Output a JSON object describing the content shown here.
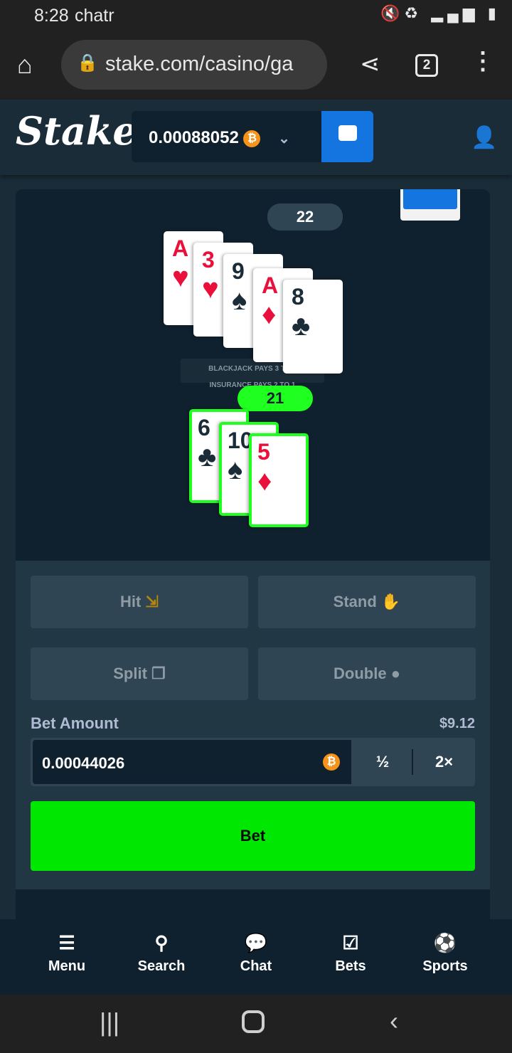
{
  "status": {
    "time": "8:28",
    "carrier": "chatr"
  },
  "browser": {
    "url": "stake.com/casino/ga",
    "tab_count": "2"
  },
  "header": {
    "logo": "Stake",
    "balance": "0.00088052",
    "currency_icon": "bitcoin-icon"
  },
  "game": {
    "dealer_total": "22",
    "dealer_cards": [
      {
        "rank": "A",
        "suit": "♥",
        "color": "red"
      },
      {
        "rank": "3",
        "suit": "♥",
        "color": "red"
      },
      {
        "rank": "9",
        "suit": "♠",
        "color": "blk"
      },
      {
        "rank": "A",
        "suit": "♦",
        "color": "red"
      },
      {
        "rank": "8",
        "suit": "♣",
        "color": "blk"
      }
    ],
    "banner_1": "BLACKJACK PAYS 3 TO 2",
    "banner_2": "INSURANCE PAYS 2 TO 1",
    "player_total": "21",
    "player_cards": [
      {
        "rank": "6",
        "suit": "♣",
        "color": "blk"
      },
      {
        "rank": "10",
        "suit": "♠",
        "color": "blk"
      },
      {
        "rank": "5",
        "suit": "♦",
        "color": "red"
      }
    ]
  },
  "controls": {
    "hit": "Hit",
    "stand": "Stand",
    "split": "Split",
    "double": "Double",
    "bet_amount_label": "Bet Amount",
    "bet_usd": "$9.12",
    "bet_value": "0.00044026",
    "half": "½",
    "double_bet": "2×",
    "bet_button": "Bet"
  },
  "nav": [
    {
      "label": "Menu",
      "icon": "☰"
    },
    {
      "label": "Search",
      "icon": "⚲"
    },
    {
      "label": "Chat",
      "icon": "💬"
    },
    {
      "label": "Bets",
      "icon": "☑"
    },
    {
      "label": "Sports",
      "icon": "⚽"
    }
  ],
  "colors": {
    "accent_green": "#00e701",
    "wallet_blue": "#1475e1",
    "win_green": "#1fff20"
  }
}
